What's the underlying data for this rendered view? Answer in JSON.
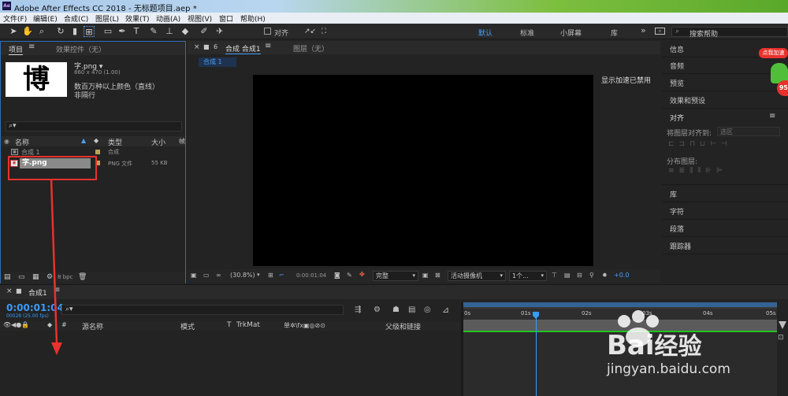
{
  "window": {
    "app_abbr": "Ae",
    "title": "Adobe After Effects CC 2018 - 无标题项目.aep *"
  },
  "menu": [
    "文件(F)",
    "编辑(E)",
    "合成(C)",
    "图层(L)",
    "效果(T)",
    "动画(A)",
    "视图(V)",
    "窗口",
    "帮助(H)"
  ],
  "toolbar": {
    "align_label": "对齐",
    "workspaces": [
      "默认",
      "标准",
      "小屏幕",
      "库"
    ],
    "overflow": "»",
    "search_help": "搜索帮助"
  },
  "project_panel": {
    "tab_project": "项目",
    "menu_glyph": "≡",
    "tab_effects": "效果控件（无）",
    "thumb_char": "博",
    "asset_name": "字.png ▾",
    "asset_size": "860 x 470 (1.00)",
    "asset_colors": "数百万种以上颜色（直线）",
    "asset_alpha": "非隔行",
    "search_glyph": "⌕▾",
    "columns": [
      "名称",
      "类型",
      "大小",
      "帧"
    ],
    "rows": [
      {
        "name": "合成 1",
        "type": "合成",
        "size": ""
      },
      {
        "name": "字.png",
        "type": "PNG 文件",
        "size": "55 KB"
      }
    ],
    "bpc": "8 bpc"
  },
  "comp_panel": {
    "tab_close": "×",
    "tab_label": "合成 合成1",
    "menu_glyph": "≡",
    "layer_tab": "图层（无）",
    "sub_tab": "合成 1",
    "gpu_notice": "显示加速已禁用",
    "zoom": "(30.8%)",
    "timecode": "0:00:01:04",
    "resolution": "完整",
    "camera": "活动摄像机",
    "views": "1个...",
    "exposure": "+0.0"
  },
  "right_panel": {
    "items": [
      "信息",
      "音频",
      "预览",
      "效果和预设"
    ],
    "align_title": "对齐",
    "align_to_label": "将图层对齐到:",
    "align_to_value": "选区",
    "distribute_label": "分布图层:",
    "lower_items": [
      "库",
      "字符",
      "段落",
      "跟踪器"
    ],
    "menu_glyph": "≡"
  },
  "ad_badge": {
    "label": "点我加速",
    "count": "95"
  },
  "timeline": {
    "tab_close": "×",
    "tab_label": "合成1",
    "menu_glyph": "≡",
    "timecode": "0:00:01:04",
    "frame_info": "00028 (25.00 fps)",
    "search_glyph": "⌕▾",
    "columns": {
      "src": "源名称",
      "mode": "模式",
      "t": "T",
      "trkmat": "TrkMat",
      "switches": "单✲\\fx▣◎⊘⊙",
      "parent": "父级和链接"
    },
    "ruler": [
      "0s",
      "01s",
      "02s",
      "03s",
      "04s",
      "05s"
    ]
  },
  "watermark": {
    "brand": "Bai",
    "brand_suffix": "经验",
    "url": "jingyan.baidu.com"
  },
  "colors": {
    "accent_blue": "#2d8cf0",
    "highlight_red": "#e8322d",
    "green_line": "#22c322"
  }
}
